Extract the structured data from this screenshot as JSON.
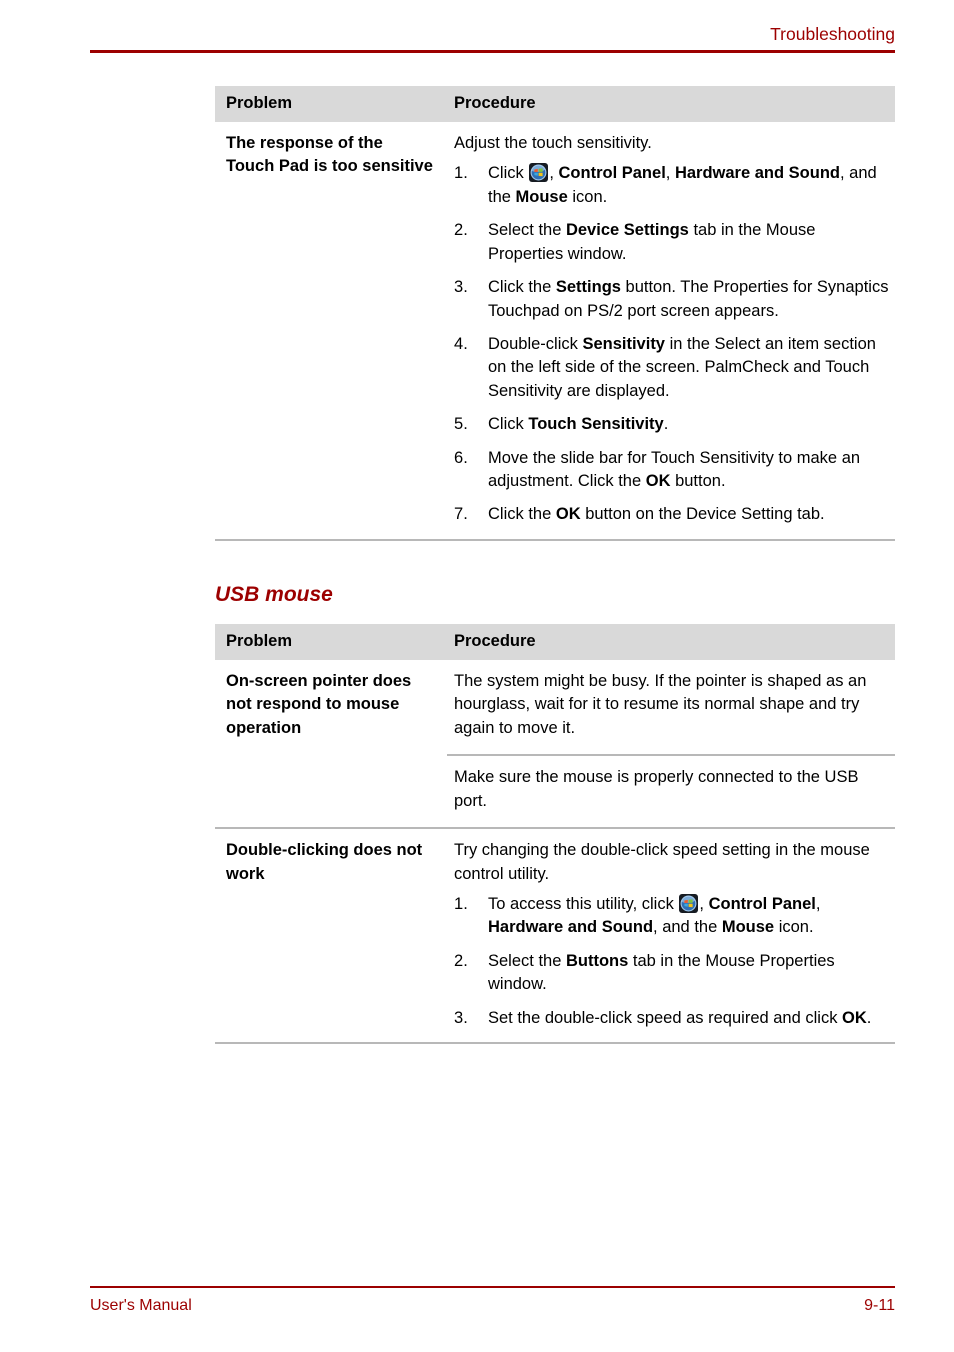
{
  "header": {
    "title": "Troubleshooting"
  },
  "footer": {
    "manual_label": "User's Manual",
    "page_number": "9-11"
  },
  "colors": {
    "accent_red": "#9c0000",
    "table_header_gray": "#d9d9d9",
    "rule_gray": "#b8b8b8",
    "text_black": "#000000"
  },
  "icons": {
    "windows_start_orb": "windows-start-orb-icon"
  },
  "tables": {
    "touchpad": {
      "headers": {
        "problem": "Problem",
        "procedure": "Procedure"
      },
      "rows": [
        {
          "problem": "The response of the Touch Pad is too sensitive",
          "intro": "Adjust the touch sensitivity.",
          "steps": [
            "Click  , Control Panel, Hardware and Sound, and the Mouse icon.",
            "Select the Device Settings tab in the Mouse Properties window.",
            "Click the Settings button. The Properties for Synaptics Touchpad on PS/2 port screen appears.",
            "Double-click Sensitivity in the Select an item section on the left side of the screen. PalmCheck and Touch Sensitivity are displayed.",
            "Click Touch Sensitivity.",
            "Move the slide bar for Touch Sensitivity to make an adjustment. Click the OK button.",
            "Click the OK button on the Device Setting tab."
          ]
        }
      ]
    },
    "usb_mouse": {
      "heading": "USB mouse",
      "headers": {
        "problem": "Problem",
        "procedure": "Procedure"
      },
      "rows": [
        {
          "problem": "On-screen pointer does not respond to mouse operation",
          "paragraph": "The system might be busy. If the pointer is shaped as an hourglass, wait for it to resume its normal shape and try again to move it."
        },
        {
          "problem": "",
          "paragraph": "Make sure the mouse is properly connected to the USB port."
        },
        {
          "problem": "Double-clicking does not work",
          "intro": "Try changing the double-click speed setting in the mouse control utility.",
          "steps": [
            "To access this utility, click  , Control Panel, Hardware and Sound, and the Mouse icon.",
            "Select the Buttons tab in the Mouse Properties window.",
            "Set the double-click speed as required and click OK."
          ]
        }
      ]
    }
  },
  "text_fragments": {
    "t1_intro": "Adjust the touch sensitivity.",
    "t1_s1_a": "Click ",
    "t1_s1_b": ", ",
    "t1_s1_c": "Control Panel",
    "t1_s1_d": ", ",
    "t1_s1_e": "Hardware and Sound",
    "t1_s1_f": ", and the ",
    "t1_s1_g": "Mouse",
    "t1_s1_h": " icon.",
    "t1_s2_a": "Select the ",
    "t1_s2_b": "Device Settings",
    "t1_s2_c": " tab in the Mouse Properties window.",
    "t1_s3_a": "Click the ",
    "t1_s3_b": "Settings",
    "t1_s3_c": " button. The Properties for Synaptics Touchpad on PS/2 port screen appears.",
    "t1_s4_a": "Double-click ",
    "t1_s4_b": "Sensitivity",
    "t1_s4_c": " in the Select an item section on the left side of the screen. PalmCheck and Touch Sensitivity are displayed.",
    "t1_s5_a": "Click ",
    "t1_s5_b": "Touch Sensitivity",
    "t1_s5_c": ".",
    "t1_s6_a": "Move the slide bar for Touch Sensitivity to make an adjustment. Click the ",
    "t1_s6_b": "OK",
    "t1_s6_c": " button.",
    "t1_s7_a": "Click the ",
    "t1_s7_b": "OK",
    "t1_s7_c": " button on the Device Setting tab.",
    "t2_r1_p": "The system might be busy. If the pointer is shaped as an hourglass, wait for it to resume its normal shape and try again to move it.",
    "t2_r2_p": "Make sure the mouse is properly connected to the USB port.",
    "t2_r3_intro": "Try changing the double-click speed setting in the mouse control utility.",
    "t2_s1_a": "To access this utility, click ",
    "t2_s1_b": ", ",
    "t2_s1_c": "Control Panel",
    "t2_s1_d": ", ",
    "t2_s1_e": "Hardware and Sound",
    "t2_s1_f": ", and the ",
    "t2_s1_g": "Mouse",
    "t2_s1_h": " icon.",
    "t2_s2_a": "Select the ",
    "t2_s2_b": "Buttons",
    "t2_s2_c": " tab in the Mouse Properties window.",
    "t2_s3_a": "Set the double-click speed as required and click ",
    "t2_s3_b": "OK",
    "t2_s3_c": "."
  }
}
